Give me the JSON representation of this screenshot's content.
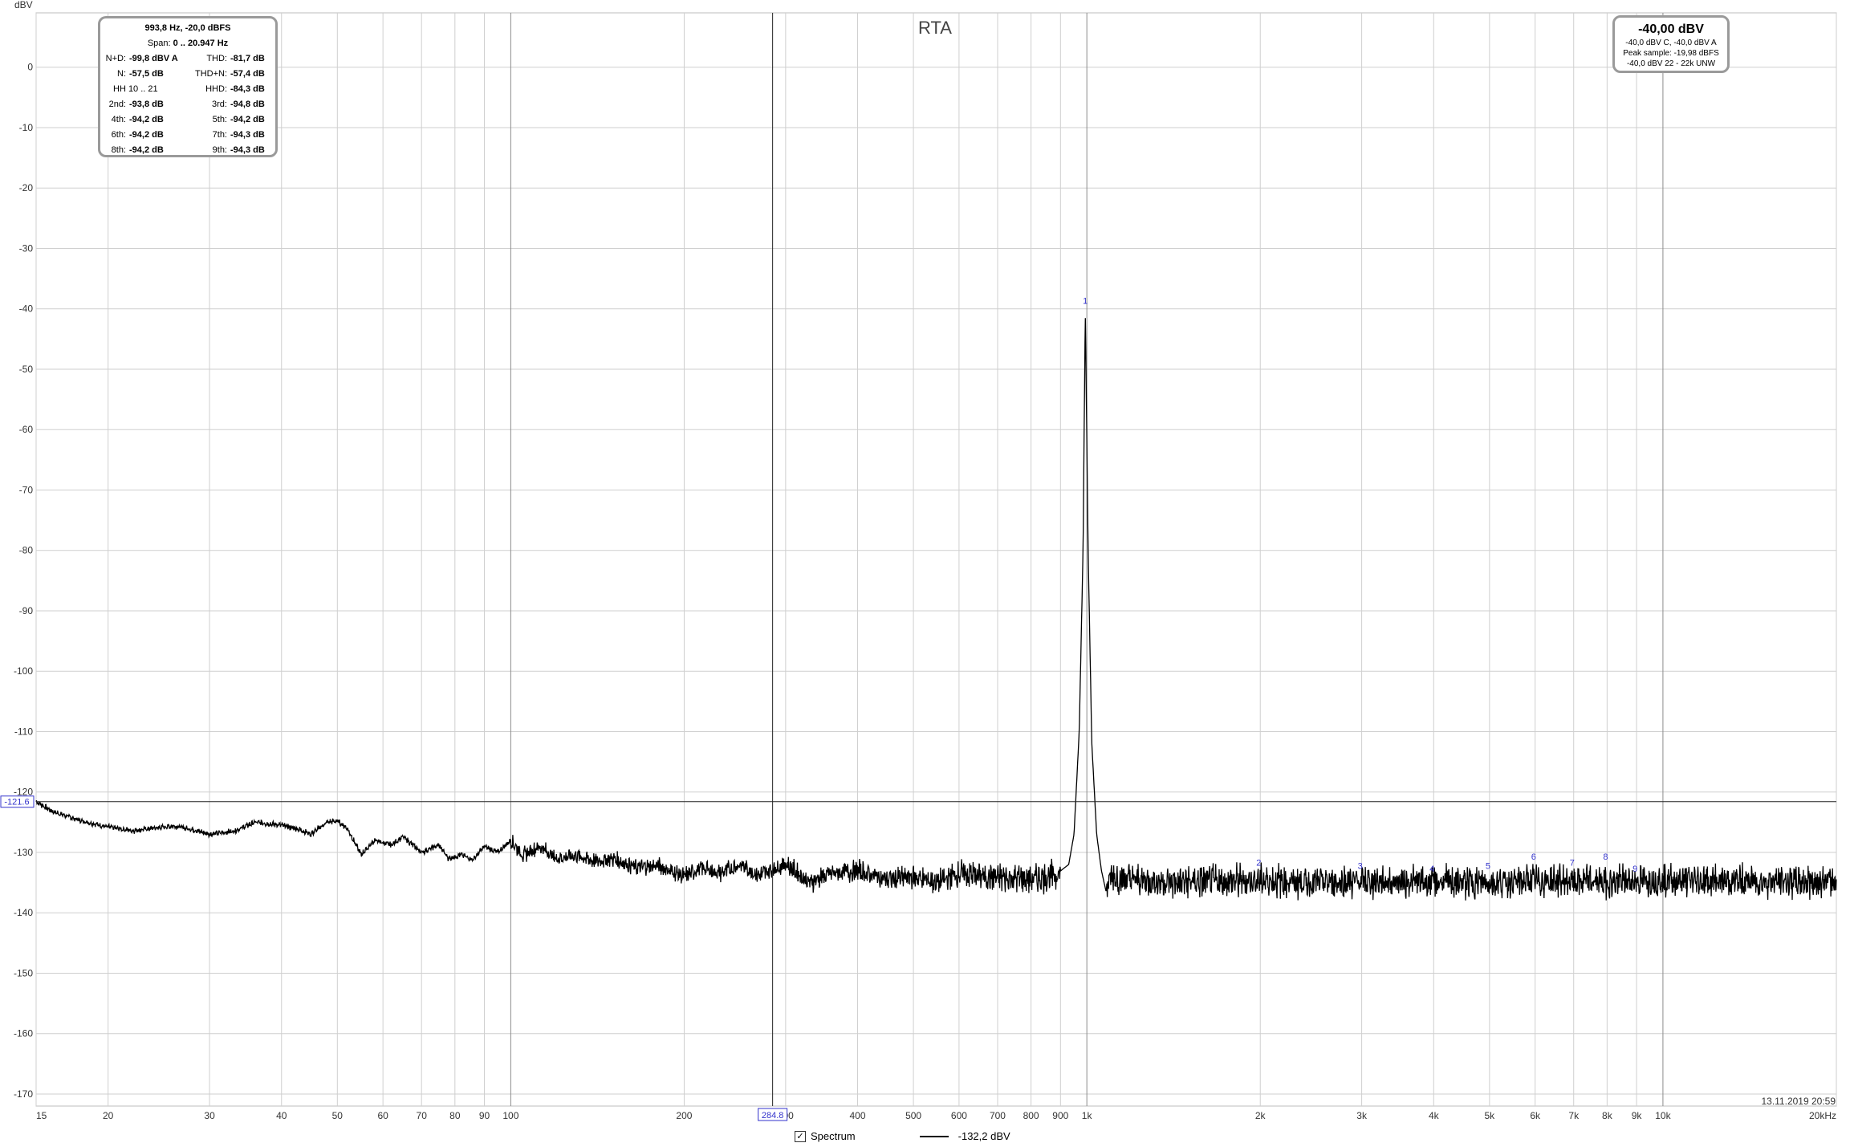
{
  "chart_data": {
    "type": "line",
    "title": "RTA",
    "ylabel": "dBV",
    "xlabel": "",
    "xscale": "log",
    "xlim": [
      15,
      20000
    ],
    "ylim": [
      -172,
      9
    ],
    "grid": true,
    "y_ticks": [
      0,
      -10,
      -20,
      -30,
      -40,
      -50,
      -60,
      -70,
      -80,
      -90,
      -100,
      -110,
      -120,
      -130,
      -140,
      -150,
      -160,
      -170
    ],
    "x_ticks": [
      {
        "v": 15,
        "t": "15"
      },
      {
        "v": 20,
        "t": "20"
      },
      {
        "v": 30,
        "t": "30"
      },
      {
        "v": 40,
        "t": "40"
      },
      {
        "v": 50,
        "t": "50"
      },
      {
        "v": 60,
        "t": "60"
      },
      {
        "v": 70,
        "t": "70"
      },
      {
        "v": 80,
        "t": "80"
      },
      {
        "v": 90,
        "t": "90"
      },
      {
        "v": 100,
        "t": "100"
      },
      {
        "v": 200,
        "t": "200"
      },
      {
        "v": 300,
        "t": "300"
      },
      {
        "v": 400,
        "t": "400"
      },
      {
        "v": 500,
        "t": "500"
      },
      {
        "v": 600,
        "t": "600"
      },
      {
        "v": 700,
        "t": "700"
      },
      {
        "v": 800,
        "t": "800"
      },
      {
        "v": 900,
        "t": "900"
      },
      {
        "v": 1000,
        "t": "1k"
      },
      {
        "v": 2000,
        "t": "2k"
      },
      {
        "v": 3000,
        "t": "3k"
      },
      {
        "v": 4000,
        "t": "4k"
      },
      {
        "v": 5000,
        "t": "5k"
      },
      {
        "v": 6000,
        "t": "6k"
      },
      {
        "v": 7000,
        "t": "7k"
      },
      {
        "v": 8000,
        "t": "8k"
      },
      {
        "v": 9000,
        "t": "9k"
      },
      {
        "v": 10000,
        "t": "10k"
      },
      {
        "v": 20000,
        "t": "20kHz"
      }
    ],
    "cursor": {
      "x": 284.8,
      "x_label": "284.8",
      "y": -121.6,
      "y_label": "-121.6"
    },
    "series": [
      {
        "name": "Spectrum",
        "color": "#000000",
        "points": [
          [
            15,
            -121.6
          ],
          [
            16,
            -123.2
          ],
          [
            18,
            -124.8
          ],
          [
            20,
            -125.8
          ],
          [
            22,
            -126.4
          ],
          [
            24,
            -126.0
          ],
          [
            26,
            -125.6
          ],
          [
            28,
            -126.2
          ],
          [
            30,
            -127.0
          ],
          [
            33,
            -126.5
          ],
          [
            36,
            -125.0
          ],
          [
            40,
            -125.5
          ],
          [
            43,
            -126.2
          ],
          [
            45,
            -127.0
          ],
          [
            48,
            -125.0
          ],
          [
            50,
            -124.8
          ],
          [
            52,
            -126.0
          ],
          [
            55,
            -130.4
          ],
          [
            58,
            -128.0
          ],
          [
            62,
            -128.8
          ],
          [
            65,
            -127.4
          ],
          [
            70,
            -130.0
          ],
          [
            75,
            -128.8
          ],
          [
            78,
            -131.0
          ],
          [
            82,
            -130.4
          ],
          [
            86,
            -131.2
          ],
          [
            90,
            -129.0
          ],
          [
            95,
            -130.0
          ],
          [
            100,
            -128.0
          ],
          [
            105,
            -130.5
          ],
          [
            112,
            -129.0
          ],
          [
            120,
            -131.0
          ],
          [
            130,
            -130.5
          ],
          [
            140,
            -131.5
          ],
          [
            150,
            -131.0
          ],
          [
            165,
            -132.5
          ],
          [
            180,
            -132.2
          ],
          [
            200,
            -134.0
          ],
          [
            215,
            -132.5
          ],
          [
            230,
            -133.5
          ],
          [
            250,
            -132.0
          ],
          [
            270,
            -133.8
          ],
          [
            300,
            -131.8
          ],
          [
            330,
            -135.0
          ],
          [
            360,
            -133.5
          ],
          [
            400,
            -133.0
          ],
          [
            450,
            -134.5
          ],
          [
            500,
            -134.0
          ],
          [
            550,
            -135.0
          ],
          [
            600,
            -133.5
          ],
          [
            700,
            -134.2
          ],
          [
            800,
            -134.4
          ],
          [
            880,
            -133.8
          ],
          [
            930,
            -132.0
          ],
          [
            950,
            -127.0
          ],
          [
            970,
            -110.0
          ],
          [
            985,
            -80.0
          ],
          [
            993.8,
            -40.0
          ],
          [
            1005,
            -80.0
          ],
          [
            1020,
            -112.0
          ],
          [
            1040,
            -127.0
          ],
          [
            1060,
            -133.0
          ],
          [
            1080,
            -136.5
          ],
          [
            1100,
            -134.0
          ],
          [
            1200,
            -134.5
          ],
          [
            1400,
            -135.0
          ],
          [
            1700,
            -134.8
          ],
          [
            2000,
            -134.6
          ],
          [
            2500,
            -135.0
          ],
          [
            3000,
            -134.8
          ],
          [
            4000,
            -134.9
          ],
          [
            5000,
            -135.0
          ],
          [
            6000,
            -134.7
          ],
          [
            7000,
            -134.8
          ],
          [
            8000,
            -134.9
          ],
          [
            10000,
            -134.6
          ],
          [
            14000,
            -134.8
          ],
          [
            20000,
            -134.8
          ]
        ]
      }
    ],
    "harmonic_markers": [
      {
        "label": "1",
        "x": 993.8,
        "y": -40.0
      },
      {
        "label": "2",
        "x": 1987.6,
        "y": -133.0
      },
      {
        "label": "3",
        "x": 2981.4,
        "y": -133.5
      },
      {
        "label": "4",
        "x": 3975.2,
        "y": -134.0
      },
      {
        "label": "5",
        "x": 4969.0,
        "y": -133.5
      },
      {
        "label": "6",
        "x": 5962.8,
        "y": -132.0
      },
      {
        "label": "7",
        "x": 6956.6,
        "y": -133.0
      },
      {
        "label": "8",
        "x": 7950.4,
        "y": -132.0
      },
      {
        "label": "9",
        "x": 8944.2,
        "y": -134.0
      }
    ]
  },
  "distortion": {
    "header1": "993,8 Hz, -20,0 dBFS",
    "header2_label": "Span:",
    "header2_value": "0 .. 20.947 Hz",
    "rows": [
      {
        "l_label": "N+D:",
        "l_value": "-99,8 dBV A",
        "r_label": "THD:",
        "r_value": "-81,7 dB"
      },
      {
        "l_label": "N:",
        "l_value": "-57,5 dB",
        "r_label": "THD+N:",
        "r_value": "-57,4 dB"
      },
      {
        "l_label": "HH 10 .. 21",
        "l_value": "",
        "r_label": "HHD:",
        "r_value": "-84,3 dB"
      },
      {
        "l_label": "2nd:",
        "l_value": "-93,8 dB",
        "r_label": "3rd:",
        "r_value": "-94,8 dB"
      },
      {
        "l_label": "4th:",
        "l_value": "-94,2 dB",
        "r_label": "5th:",
        "r_value": "-94,2 dB"
      },
      {
        "l_label": "6th:",
        "l_value": "-94,2 dB",
        "r_label": "7th:",
        "r_value": "-94,3 dB"
      },
      {
        "l_label": "8th:",
        "l_value": "-94,2 dB",
        "r_label": "9th:",
        "r_value": "-94,3 dB"
      }
    ]
  },
  "level": {
    "main": "-40,00 dBV",
    "line1": "-40,0 dBV C, -40,0 dBV A",
    "line2": "Peak sample: -19,98 dBFS",
    "line3": "-40,0 dBV 22 - 22k UNW"
  },
  "footer": {
    "checkbox_mark": "✓",
    "series_name": "Spectrum",
    "series_value": "-132,2 dBV"
  },
  "timestamp": "13.11.2019 20:59"
}
